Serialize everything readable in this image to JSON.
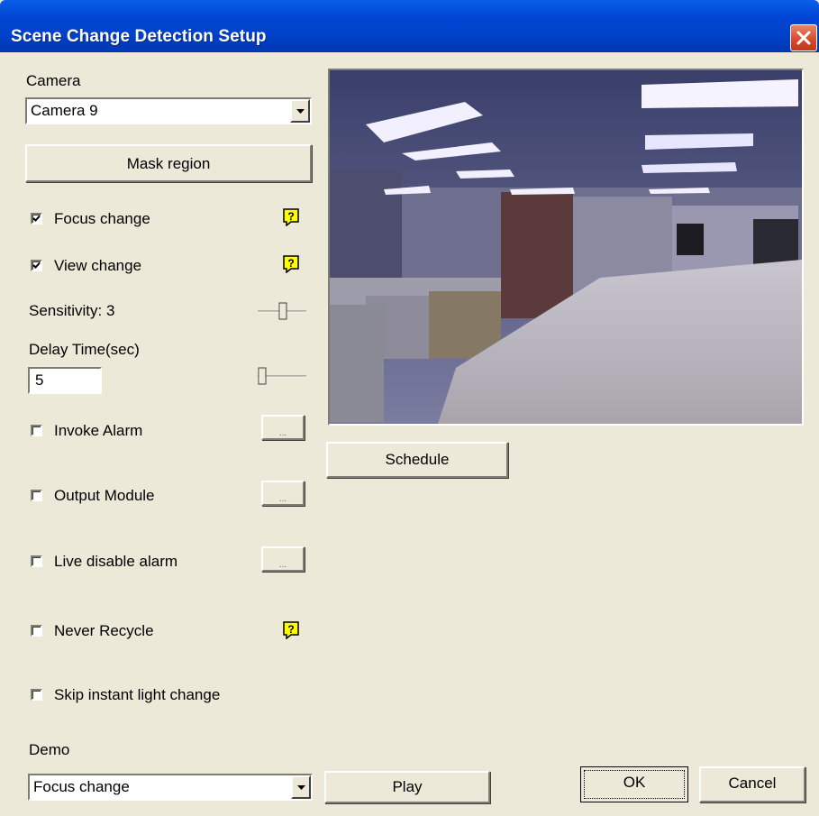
{
  "window": {
    "title": "Scene Change Detection Setup"
  },
  "camera": {
    "label": "Camera",
    "selected": "Camera 9"
  },
  "mask_region_label": "Mask region",
  "focus_change": {
    "label": "Focus change",
    "checked": true
  },
  "view_change": {
    "label": "View change",
    "checked": true
  },
  "sensitivity": {
    "label": "Sensitivity: 3",
    "value": 3
  },
  "delay_time": {
    "label": "Delay Time(sec)",
    "value": "5"
  },
  "invoke_alarm": {
    "label": "Invoke Alarm",
    "checked": false,
    "button": "..."
  },
  "output_module": {
    "label": "Output Module",
    "checked": false,
    "button": "..."
  },
  "live_disable_alarm": {
    "label": "Live disable alarm",
    "checked": false,
    "button": "..."
  },
  "never_recycle": {
    "label": "Never Recycle",
    "checked": false
  },
  "skip_light_change": {
    "label": "Skip instant light change",
    "checked": false
  },
  "help_icon": "?",
  "schedule_label": "Schedule",
  "demo": {
    "label": "Demo",
    "selected": "Focus change",
    "play_label": "Play"
  },
  "ok_label": "OK",
  "cancel_label": "Cancel",
  "colors": {
    "titlebar": "#0046d5",
    "dialog": "#ece9d8",
    "help_icon": "#ffff00"
  }
}
